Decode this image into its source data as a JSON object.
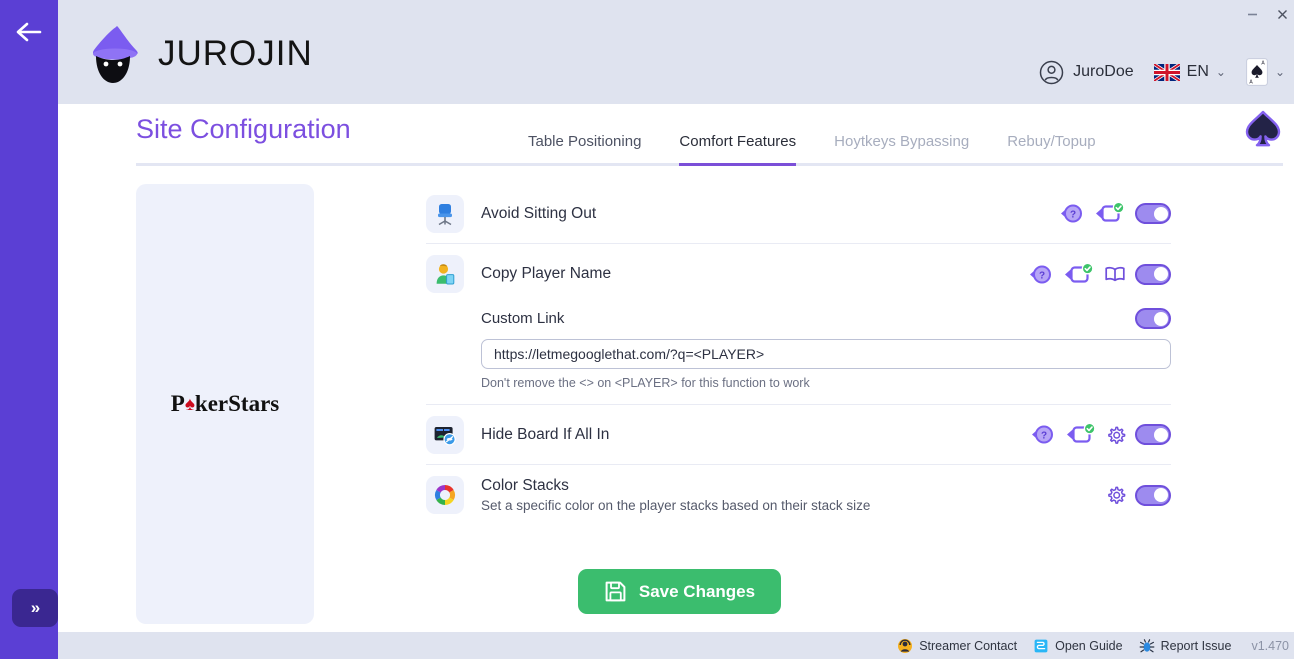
{
  "window": {
    "minimize_label": "—",
    "close_label": "✕"
  },
  "rail": {
    "back_icon": "arrow-left-icon",
    "expand_label": "»"
  },
  "header": {
    "brand_name": "JUROJIN",
    "logo_icon": "wizard-logo-icon",
    "user": {
      "avatar_icon": "user-circle-icon",
      "name": "JuroDoe",
      "chevron": "⌄"
    },
    "language": {
      "flag_icon": "uk-flag-icon",
      "code": "EN",
      "chevron": "⌄"
    },
    "site": {
      "card_icon": "ace-of-spades-icon",
      "chevron": "⌄"
    }
  },
  "page": {
    "title": "Site Configuration",
    "spade_icon": "spade-logo-icon",
    "tabs": [
      {
        "label": "Table Positioning",
        "active": false,
        "disabled": false
      },
      {
        "label": "Comfort Features",
        "active": true,
        "disabled": false
      },
      {
        "label": "Hoytkeys Bypassing",
        "active": false,
        "disabled": true
      },
      {
        "label": "Rebuy/Topup",
        "active": false,
        "disabled": true
      }
    ]
  },
  "sidecard": {
    "site_name_prefix": "P",
    "site_name_spade": "♠",
    "site_name_suffix": "kerStars"
  },
  "settings": {
    "rows": [
      {
        "icon": "office-chair-icon",
        "label": "Avoid Sitting Out",
        "sub": "",
        "controls": [
          "help-bubble-icon",
          "tooltip-check-icon",
          "toggle-on"
        ]
      },
      {
        "icon": "player-card-icon",
        "label": "Copy Player Name",
        "sub": "",
        "controls": [
          "help-bubble-icon",
          "tooltip-check-icon",
          "book-icon",
          "toggle-on"
        ]
      },
      {
        "icon": "hide-board-icon",
        "label": "Hide Board If All In",
        "sub": "",
        "controls": [
          "help-bubble-icon",
          "tooltip-check-icon",
          "gear-icon",
          "toggle-on"
        ]
      },
      {
        "icon": "color-wheel-icon",
        "label": "Color Stacks",
        "sub": "Set a specific color on the player stacks based on their stack size",
        "controls": [
          "gear-icon",
          "toggle-on"
        ]
      }
    ],
    "custom_link": {
      "label": "Custom Link",
      "value": "https://letmegooglethat.com/?q=<PLAYER>",
      "placeholder": "https://letmegooglethat.com/?q=<PLAYER>",
      "hint": "Don't remove the <> on <PLAYER> for this function to work",
      "toggle": "toggle-on"
    }
  },
  "actions": {
    "save_label": "Save Changes",
    "save_icon": "floppy-save-icon",
    "save_color": "#3bbd6e"
  },
  "statusbar": {
    "items": [
      {
        "icon": "headset-icon",
        "label": "Streamer Contact"
      },
      {
        "icon": "book-blue-icon",
        "label": "Open Guide"
      },
      {
        "icon": "bug-icon",
        "label": "Report Issue"
      }
    ],
    "version": "v1.470"
  },
  "colors": {
    "brand_purple": "#5b3fd4",
    "title_purple": "#7c4fe0",
    "header_bg": "#dfe3ef",
    "accent_green": "#3bbd6e"
  }
}
